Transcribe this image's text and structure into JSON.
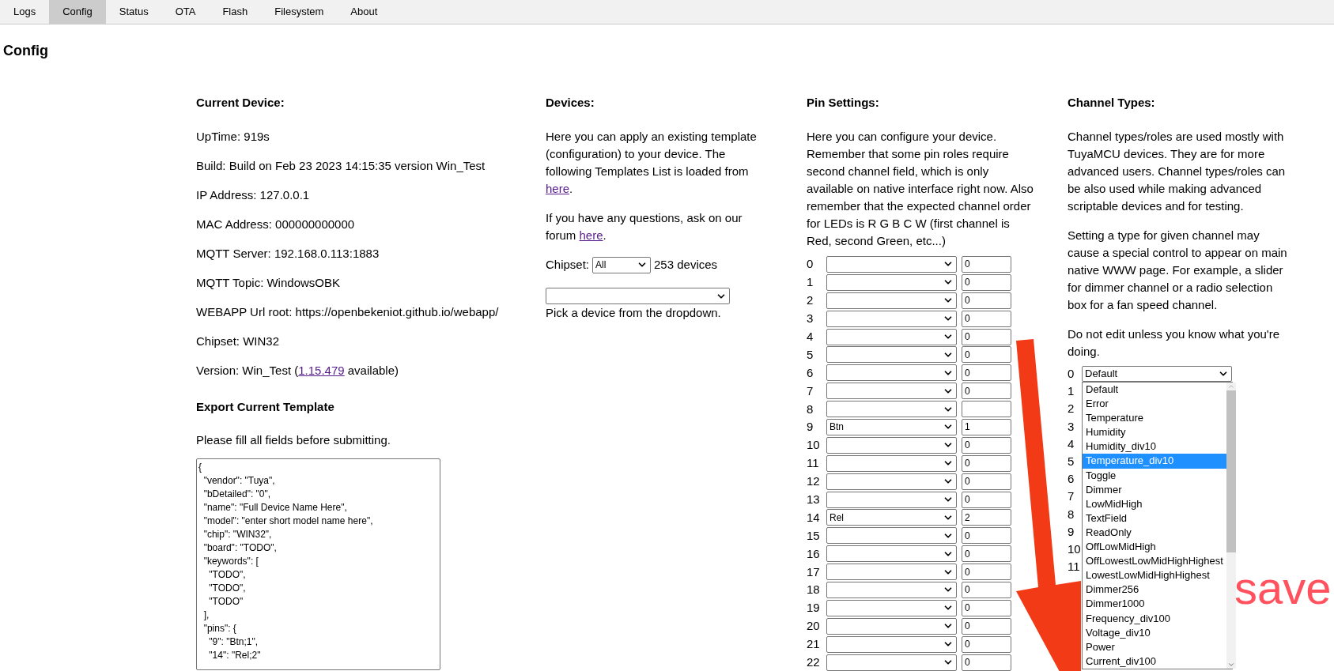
{
  "tabs": [
    {
      "label": "Logs",
      "selected": false
    },
    {
      "label": "Config",
      "selected": true
    },
    {
      "label": "Status",
      "selected": false
    },
    {
      "label": "OTA",
      "selected": false
    },
    {
      "label": "Flash",
      "selected": false
    },
    {
      "label": "Filesystem",
      "selected": false
    },
    {
      "label": "About",
      "selected": false
    }
  ],
  "page_title": "Config",
  "current_device": {
    "heading": "Current Device:",
    "lines": [
      "UpTime: 919s",
      "Build: Build on Feb 23 2023 14:15:35 version Win_Test",
      "IP Address: 127.0.0.1",
      "MAC Address: 000000000000",
      "MQTT Server: 192.168.0.113:1883",
      "MQTT Topic: WindowsOBK",
      "WEBAPP Url root: https://openbekeniot.github.io/webapp/",
      "Chipset: WIN32"
    ],
    "version": {
      "prefix": "Version: Win_Test (",
      "link": "1.15.479",
      "suffix": " available)"
    }
  },
  "export_template": {
    "heading": "Export Current Template",
    "note": "Please fill all fields before submitting.",
    "template": "{\n  \"vendor\": \"Tuya\",\n  \"bDetailed\": \"0\",\n  \"name\": \"Full Device Name Here\",\n  \"model\": \"enter short model name here\",\n  \"chip\": \"WIN32\",\n  \"board\": \"TODO\",\n  \"keywords\": [\n    \"TODO\",\n    \"TODO\",\n    \"TODO\"\n  ],\n  \"pins\": {\n    \"9\": \"Btn;1\",\n    \"14\": \"Rel;2\""
  },
  "devices": {
    "heading": "Devices:",
    "paragraphs": [
      {
        "text": "Here you can apply an existing template (configuration) to your device. The following Templates List is loaded from ",
        "link": "here",
        "suffix": "."
      },
      {
        "text": "If you have any questions, ask on our forum ",
        "link": "here",
        "suffix": "."
      }
    ],
    "chipset": {
      "label": "Chipset:",
      "value": "All"
    },
    "device_count": "253 devices",
    "hint": "Pick a device from the dropdown."
  },
  "pin_settings": {
    "heading": "Pin Settings:",
    "description": "Here you can configure your device. Remember that some pin roles require second channel field, which is only available on native interface right now. Also remember that the expected channel order for LEDs is R G B C W (first channel is Red, second Green, etc...)",
    "pins": [
      {
        "label": "0",
        "channel": "0"
      },
      {
        "label": "1",
        "channel": "0"
      },
      {
        "label": "2",
        "channel": "0"
      },
      {
        "label": "3",
        "channel": "0"
      },
      {
        "label": "4",
        "channel": "0"
      },
      {
        "label": "5",
        "channel": "0"
      },
      {
        "label": "6",
        "channel": "0"
      },
      {
        "label": "7",
        "channel": "0"
      },
      {
        "label": "8"
      },
      {
        "label": "9",
        "role": "Btn",
        "channel": "1"
      },
      {
        "label": "10",
        "channel": "0"
      },
      {
        "label": "11",
        "channel": "0"
      },
      {
        "label": "12",
        "channel": "0"
      },
      {
        "label": "13",
        "channel": "0"
      },
      {
        "label": "14",
        "role": "Rel",
        "channel": "2"
      },
      {
        "label": "15",
        "channel": "0"
      },
      {
        "label": "16",
        "channel": "0"
      },
      {
        "label": "17",
        "channel": "0"
      },
      {
        "label": "18",
        "channel": "0"
      },
      {
        "label": "19",
        "channel": "0"
      },
      {
        "label": "20",
        "channel": "0"
      },
      {
        "label": "21",
        "channel": "0"
      },
      {
        "label": "22",
        "channel": "0"
      }
    ]
  },
  "channel_types": {
    "heading": "Channel Types:",
    "paragraphs": [
      "Channel types/roles are used mostly with TuyaMCU devices. They are for more advanced users. Channel types/roles can be also used while making advanced scriptable devices and for testing.",
      "Setting a type for given channel may cause a special control to appear on main native WWW page. For example, a slider for dimmer channel or a radio selection box for a fan speed channel.",
      "Do not edit unless you know what you're doing."
    ],
    "channels": [
      {
        "label": "0",
        "value": "Default"
      },
      {
        "label": "1"
      },
      {
        "label": "2"
      },
      {
        "label": "3"
      },
      {
        "label": "4"
      },
      {
        "label": "5"
      },
      {
        "label": "6"
      },
      {
        "label": "7"
      },
      {
        "label": "8"
      },
      {
        "label": "9"
      },
      {
        "label": "10"
      },
      {
        "label": "11"
      }
    ],
    "dropdown_options": [
      {
        "label": "Default",
        "selected": false
      },
      {
        "label": "Error",
        "selected": false
      },
      {
        "label": "Temperature",
        "selected": false
      },
      {
        "label": "Humidity",
        "selected": false
      },
      {
        "label": "Humidity_div10",
        "selected": false
      },
      {
        "label": "Temperature_div10",
        "selected": true
      },
      {
        "label": "Toggle",
        "selected": false
      },
      {
        "label": "Dimmer",
        "selected": false
      },
      {
        "label": "LowMidHigh",
        "selected": false
      },
      {
        "label": "TextField",
        "selected": false
      },
      {
        "label": "ReadOnly",
        "selected": false
      },
      {
        "label": "OffLowMidHigh",
        "selected": false
      },
      {
        "label": "OffLowestLowMidHighHighest",
        "selected": false
      },
      {
        "label": "LowestLowMidHighHighest",
        "selected": false
      },
      {
        "label": "Dimmer256",
        "selected": false
      },
      {
        "label": "Dimmer1000",
        "selected": false
      },
      {
        "label": "Frequency_div100",
        "selected": false
      },
      {
        "label": "Voltage_div10",
        "selected": false
      },
      {
        "label": "Power",
        "selected": false
      },
      {
        "label": "Current_div100",
        "selected": false
      }
    ]
  },
  "annotation": {
    "text": "save"
  }
}
